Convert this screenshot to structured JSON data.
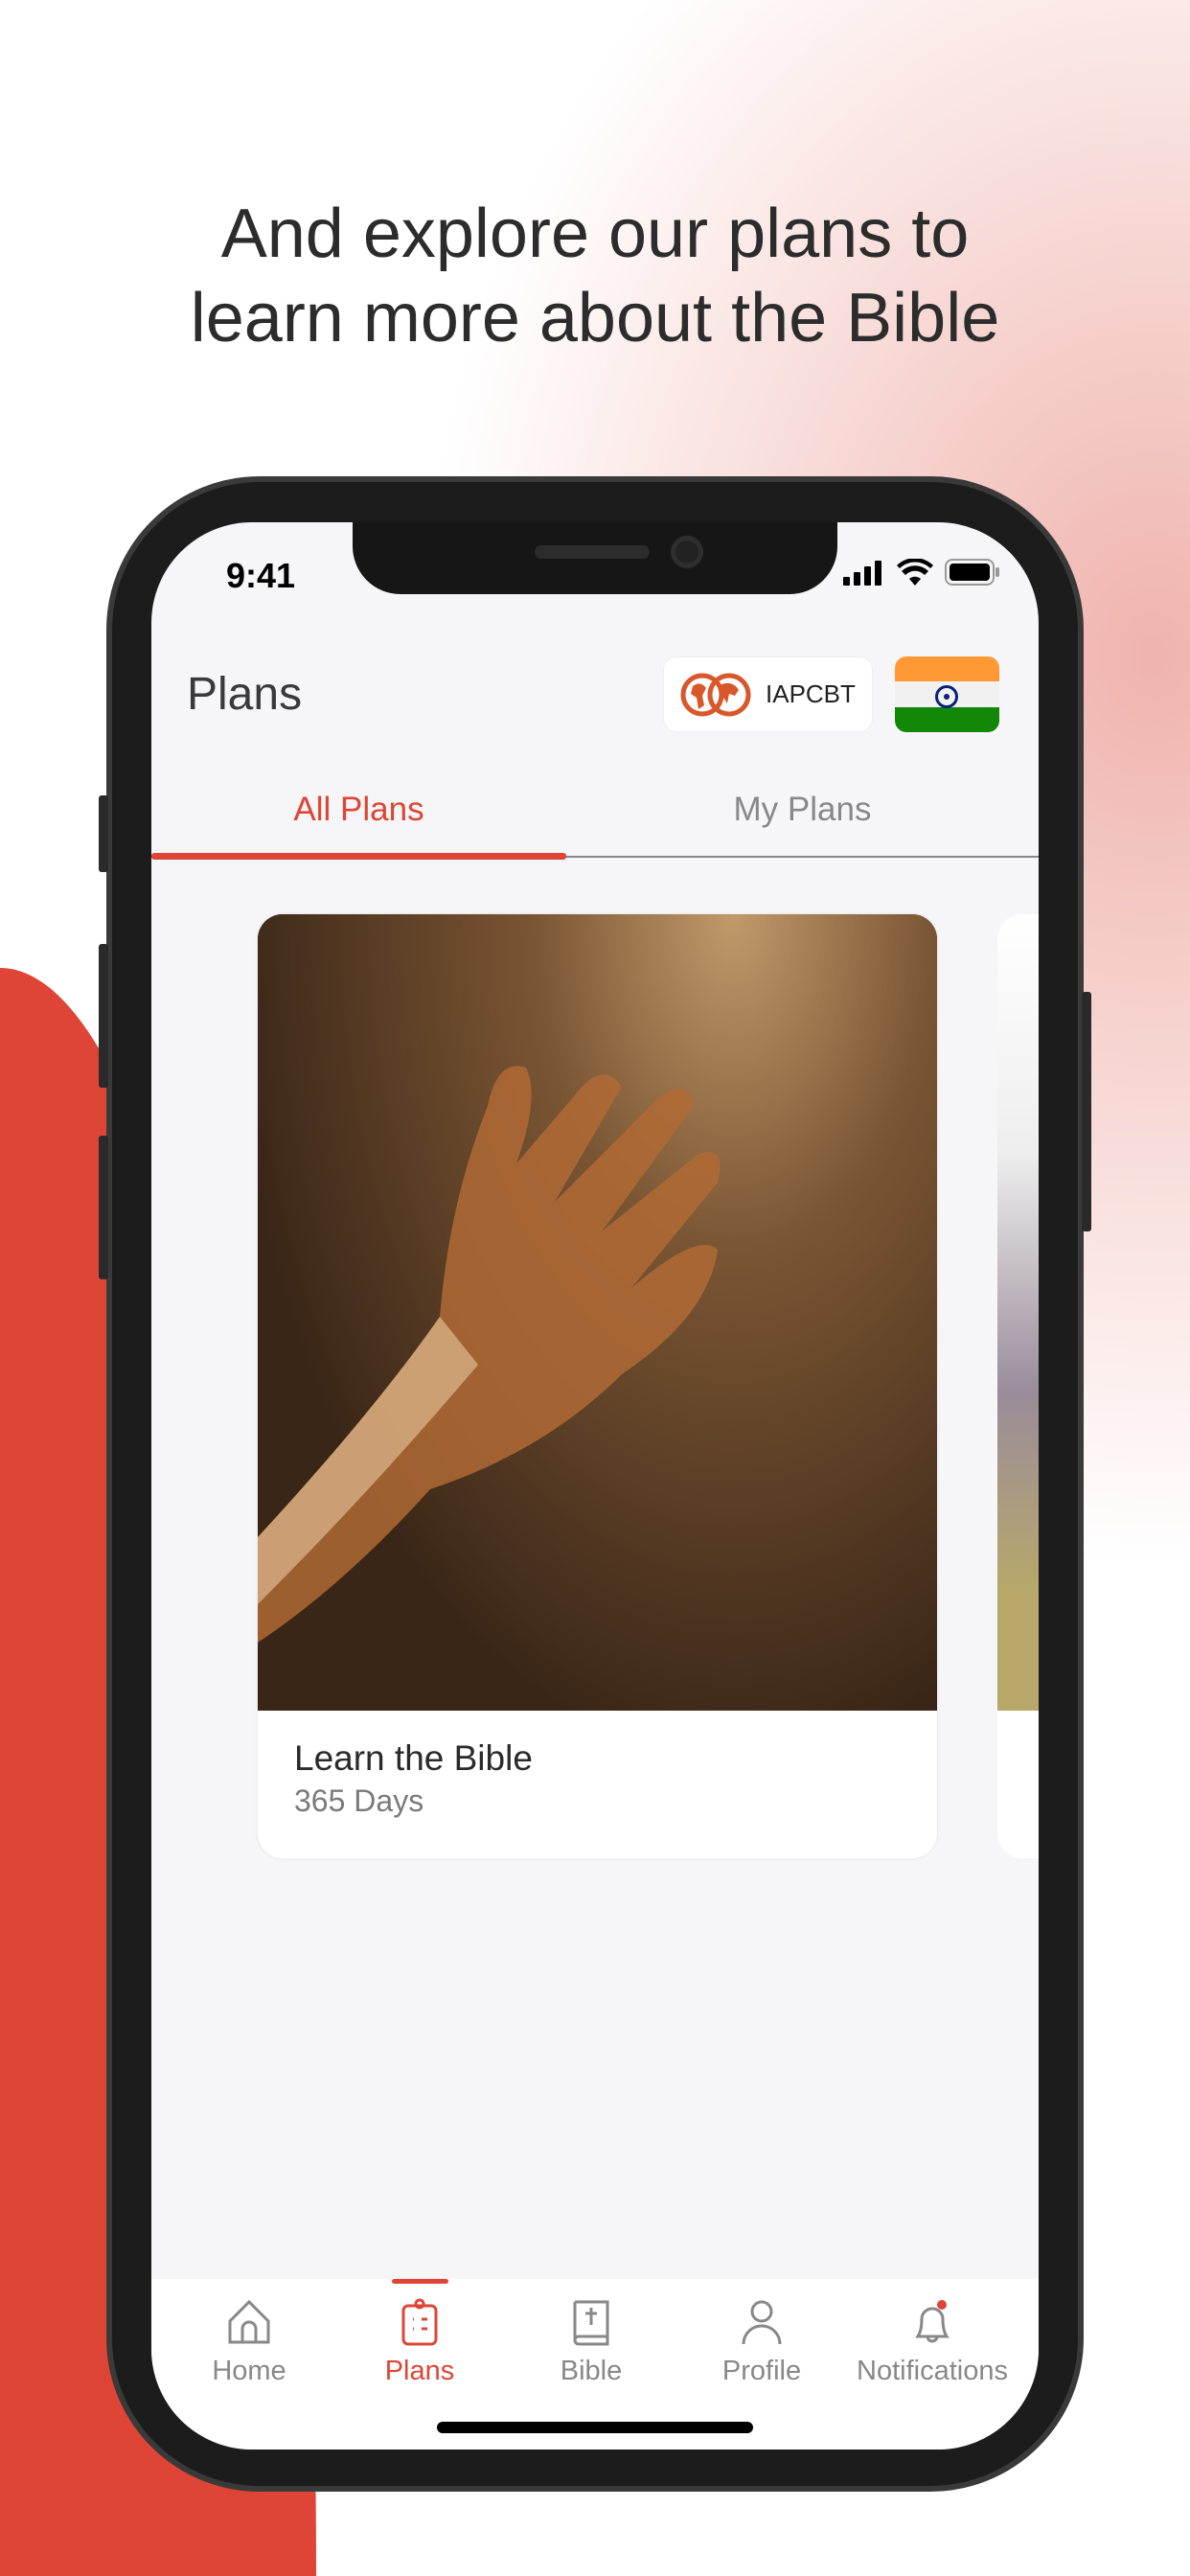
{
  "headline": {
    "line1": "And explore our plans to",
    "line2": "learn more about the Bible"
  },
  "status_bar": {
    "time": "9:41"
  },
  "header": {
    "title": "Plans",
    "org_label": "IAPCBT",
    "org_icon": "globe-logo-icon",
    "country_flag": "india-flag"
  },
  "tabs": [
    {
      "label": "All Plans",
      "active": true
    },
    {
      "label": "My Plans",
      "active": false
    }
  ],
  "plans": [
    {
      "title": "Learn the Bible",
      "duration": "365 Days"
    }
  ],
  "bottom_nav": [
    {
      "label": "Home",
      "icon": "home-icon"
    },
    {
      "label": "Plans",
      "icon": "clipboard-icon",
      "active": true
    },
    {
      "label": "Bible",
      "icon": "bible-icon"
    },
    {
      "label": "Profile",
      "icon": "user-icon"
    },
    {
      "label": "Notifications",
      "icon": "bell-icon",
      "badge": true
    }
  ],
  "colors": {
    "accent": "#de4536",
    "inactive": "#888888",
    "background": "#f6f6f8"
  }
}
